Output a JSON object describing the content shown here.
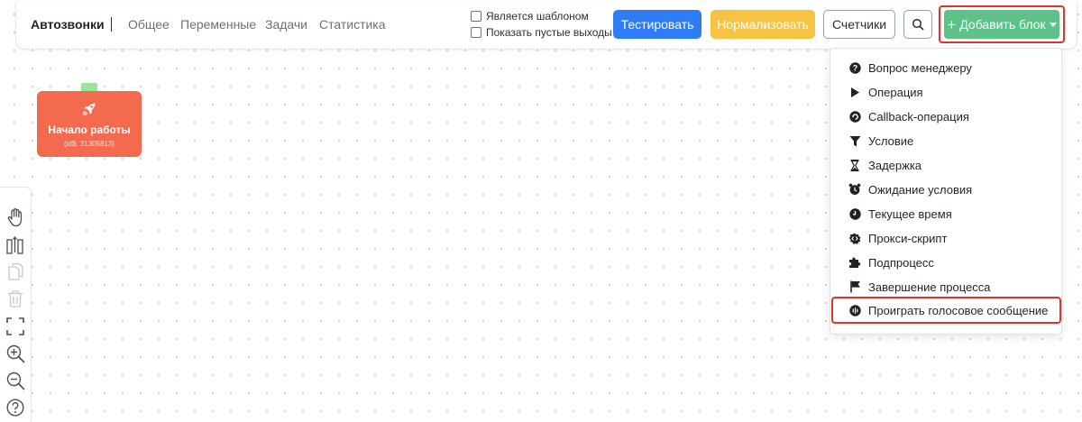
{
  "header": {
    "brand": "Автозвонки",
    "nav": [
      "Общее",
      "Переменные",
      "Задачи",
      "Статистика"
    ],
    "checkbox_template": "Является шаблоном",
    "checkbox_empty_outputs": "Показать пустые выходы",
    "btn_test": "Тестировать",
    "btn_normalize": "Нормализовать",
    "btn_counters": "Счетчики",
    "btn_add": "Добавить блок"
  },
  "menu": {
    "items": [
      {
        "label": "Вопрос менеджеру",
        "icon": "question-circle-icon"
      },
      {
        "label": "Операция",
        "icon": "play-icon"
      },
      {
        "label": "Callback-операция",
        "icon": "callback-icon"
      },
      {
        "label": "Условие",
        "icon": "filter-icon"
      },
      {
        "label": "Задержка",
        "icon": "hourglass-icon"
      },
      {
        "label": "Ожидание условия",
        "icon": "alarm-clock-icon"
      },
      {
        "label": "Текущее время",
        "icon": "clock-icon"
      },
      {
        "label": "Прокси-скрипт",
        "icon": "proxy-script-icon"
      },
      {
        "label": "Подпроцесс",
        "icon": "puzzle-icon"
      },
      {
        "label": "Завершение процесса",
        "icon": "flag-icon"
      },
      {
        "label": "Проиграть голосовое сообщение",
        "icon": "voice-message-icon"
      }
    ]
  },
  "node": {
    "title": "Начало работы",
    "id_text": "(id$: 31305813)",
    "icon": "rocket-icon"
  },
  "colors": {
    "test": "#2e7cf6",
    "normalize": "#f6c343",
    "add": "#5cc28a",
    "node": "#f46a4f",
    "highlight": "#e0322f"
  }
}
